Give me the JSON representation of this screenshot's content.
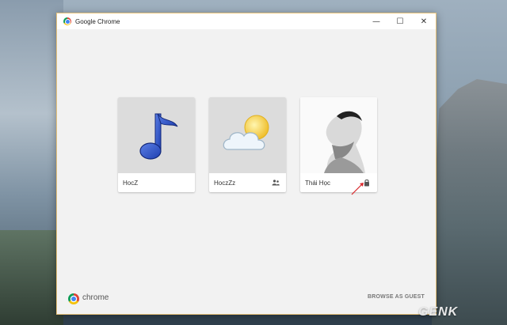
{
  "window": {
    "title": "Google Chrome"
  },
  "controls": {
    "minimize": "—",
    "maximize": "☐",
    "close": "✕"
  },
  "profiles": [
    {
      "name": "HocZ",
      "avatar": "music-note-icon"
    },
    {
      "name": "HoczZz",
      "avatar": "weather-sun-cloud-icon",
      "badge": "supervised-user-icon"
    },
    {
      "name": "Thái Học",
      "avatar": "profile-photo",
      "badge": "lock-icon"
    }
  ],
  "footer": {
    "brand": "chrome",
    "guest_button": "BROWSE AS GUEST"
  },
  "watermark": "GENK"
}
